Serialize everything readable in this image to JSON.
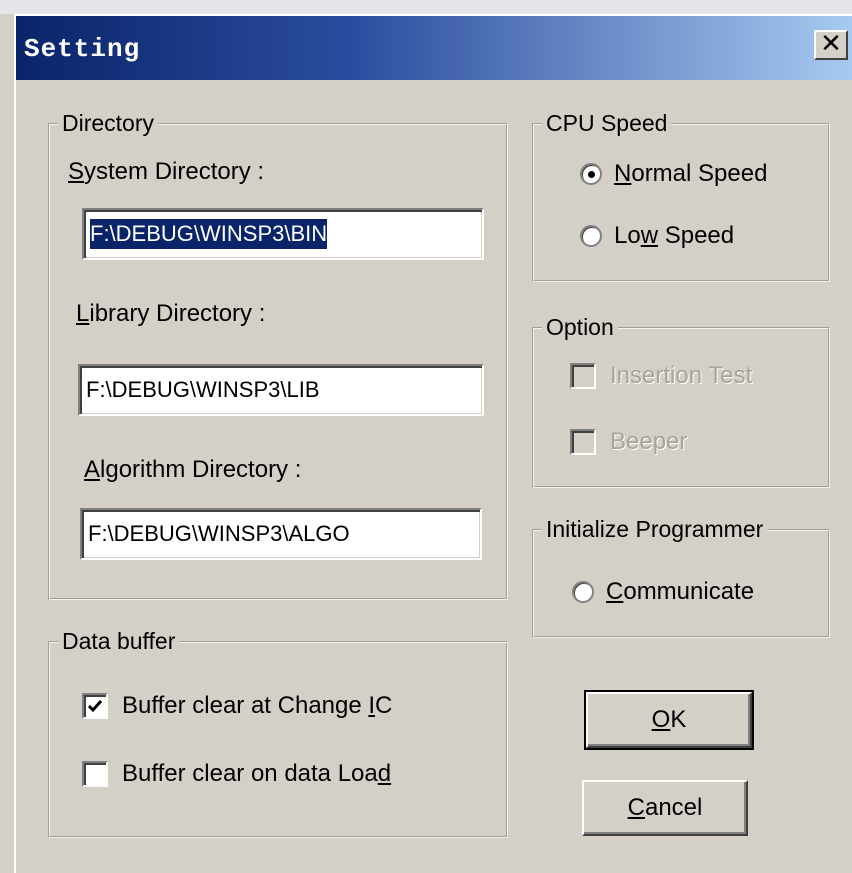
{
  "window": {
    "title": "Setting",
    "close_glyph": "✕"
  },
  "directory": {
    "legend": "Directory",
    "system_label_hot": "S",
    "system_label_rest": "ystem Directory :",
    "system_value": "F:\\DEBUG\\WINSP3\\BIN",
    "library_label_hot": "L",
    "library_label_rest": "ibrary Directory :",
    "library_value": "F:\\DEBUG\\WINSP3\\LIB",
    "algorithm_label_hot": "A",
    "algorithm_label_rest": "lgorithm Directory :",
    "algorithm_value": "F:\\DEBUG\\WINSP3\\ALGO"
  },
  "cpu_speed": {
    "legend": "CPU Speed",
    "normal_hot": "N",
    "normal_rest": "ormal Speed",
    "normal_selected": true,
    "low_pre": "Lo",
    "low_hot": "w",
    "low_rest": " Speed",
    "low_selected": false
  },
  "option": {
    "legend": "Option",
    "insertion_label": "Insertion Test",
    "beeper_label": "Beeper",
    "enabled": false
  },
  "init_programmer": {
    "legend": "Initialize Programmer",
    "communicate_hot": "C",
    "communicate_rest": "ommunicate"
  },
  "data_buffer": {
    "legend": "Data buffer",
    "change_ic_pre": "Buffer clear at Change ",
    "change_ic_hot": "I",
    "change_ic_rest": "C",
    "change_ic_checked": true,
    "data_load_pre": "Buffer clear on data Loa",
    "data_load_hot": "d",
    "data_load_checked": false
  },
  "buttons": {
    "ok_hot": "O",
    "ok_rest": "K",
    "cancel_hot": "C",
    "cancel_rest": "ancel"
  },
  "colors": {
    "title_active": "#0a246a",
    "face": "#d4d0c8",
    "selection": "#0a246a"
  }
}
